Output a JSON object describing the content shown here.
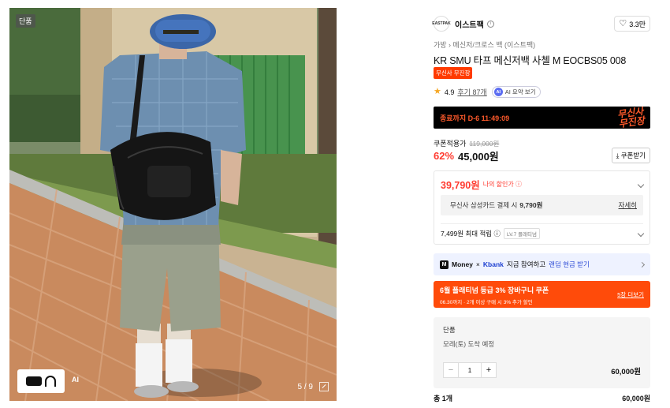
{
  "gallery": {
    "tag": "단품",
    "counter": "5 / 9",
    "thumb_label": "AI"
  },
  "brand": {
    "logo_text": "EASTPAK",
    "name": "이스트팩",
    "info_icon": "info-icon",
    "like_count": "3.3만"
  },
  "breadcrumb": "가방 › 메신저/크로스 백 (이스트팩)",
  "product": {
    "title": "KR SMU 타프 메신저백 사첼 M EOCBS05 008",
    "badge": "무신사 무진장"
  },
  "rating": {
    "score": "4.9",
    "review_link": "후기 87개",
    "ai_icon": "AI",
    "ai_label": "AI 요약 보기"
  },
  "event_banner": {
    "countdown": "종료까지 D-6 11:49:09",
    "logo_line1": "무신사",
    "logo_line2": "무진장"
  },
  "price": {
    "coupon_label": "쿠폰적용가",
    "original": "119,000원",
    "discount": "62%",
    "sale": "45,000원",
    "coupon_button": "⤓ 쿠폰받기"
  },
  "benefit": {
    "my_price": "39,790원",
    "my_price_label": "나의 할인가 ⓘ",
    "card_text": "무신사 삼성카드 결제 시",
    "card_amount": "9,790원",
    "card_detail": "자세히",
    "points": "7,499원 최대 적립 ⓘ",
    "level": "LV.7 플래티넘"
  },
  "kbank": {
    "m_icon": "M",
    "money": "Money",
    "x": "×",
    "kbank": "Kbank",
    "text": "지금 참여하고",
    "link": "랜덤 현금 받기"
  },
  "coupon_banner": {
    "title": "6월 플래티넘 등급 3% 장바구니 쿠폰",
    "sub": "06.30까지 · 2개 이상 구매 시 3% 추가 할인",
    "link": "5장 더보기"
  },
  "option": {
    "title": "단품",
    "delivery": "모레(토) 도착 예정",
    "minus": "−",
    "qty": "1",
    "plus": "+",
    "price": "60,000원"
  },
  "total": {
    "label": "총 1개",
    "value": "60,000원"
  },
  "colors": {
    "accent": "#ff3b30",
    "orange": "#ff4b0a",
    "kbank_bg": "#eef2ff"
  }
}
